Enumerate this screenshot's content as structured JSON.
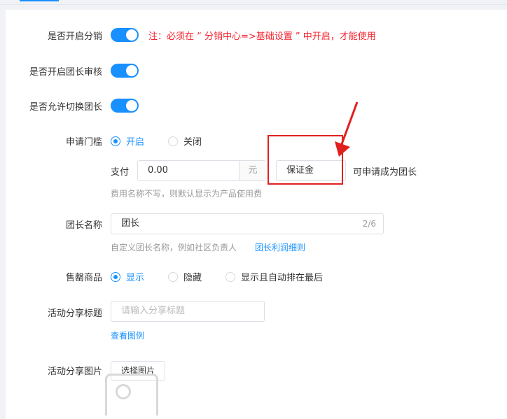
{
  "settings": {
    "enable_distribution": {
      "label": "是否开启分销",
      "note": "注：必须在 “ 分销中心=>基础设置 ” 中开启，才能使用"
    },
    "enable_leader_review": {
      "label": "是否开启团长审核"
    },
    "allow_switch_leader": {
      "label": "是否允许切换团长"
    },
    "apply_threshold": {
      "label": "申请门槛",
      "options": [
        "开启",
        "关闭"
      ],
      "selected": "开启",
      "pay_label": "支付",
      "amount": "0.00",
      "unit": "元",
      "fee_name": "保证金",
      "suffix": "可申请成为团长",
      "hint": "费用名称不写，则默认显示为产品使用费"
    },
    "leader_name": {
      "label": "团长名称",
      "value": "团长",
      "count": "2/6",
      "hint": "自定义团长名称，例如社区负责人",
      "link": "团长利润细则"
    },
    "sold_out_products": {
      "label": "售罄商品",
      "options": [
        "显示",
        "隐藏",
        "显示且自动排在最后"
      ],
      "selected": "显示"
    },
    "share_title": {
      "label": "活动分享标题",
      "placeholder": "请输入分享标题",
      "link": "查看图例"
    },
    "share_image": {
      "label": "活动分享图片",
      "button": "选择图片"
    }
  },
  "colors": {
    "accent": "#1890ff",
    "warning": "#f5222d",
    "annotation": "#e02020"
  }
}
